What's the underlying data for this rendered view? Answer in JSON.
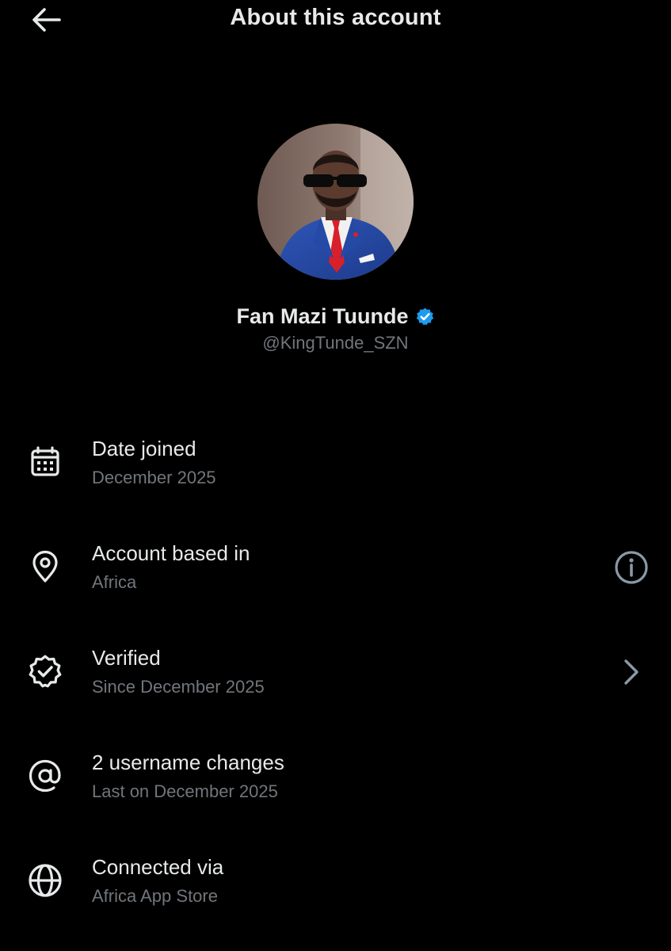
{
  "header": {
    "title": "About this account",
    "back_icon": "arrow-left-icon"
  },
  "profile": {
    "display_name": "Fan Mazi Tuunde",
    "handle": "@KingTunde_SZN",
    "verified_color": "#1d9bf0",
    "avatar": "profile-photo"
  },
  "rows": [
    {
      "icon": "calendar-icon",
      "title": "Date joined",
      "subtitle": "December 2025"
    },
    {
      "icon": "location-pin-icon",
      "title": "Account based in",
      "subtitle": "Africa",
      "trailing_icon": "info-icon"
    },
    {
      "icon": "verified-check-icon",
      "title": "Verified",
      "subtitle": "Since December 2025",
      "trailing_icon": "chevron-right-icon"
    },
    {
      "icon": "at-sign-icon",
      "title": "2 username changes",
      "subtitle": "Last on December 2025"
    },
    {
      "icon": "globe-icon",
      "title": "Connected via",
      "subtitle": "Africa App Store"
    }
  ],
  "colors": {
    "background": "#000000",
    "primary_text": "#e7e9ea",
    "secondary_text": "#71767b",
    "accent": "#1d9bf0"
  }
}
